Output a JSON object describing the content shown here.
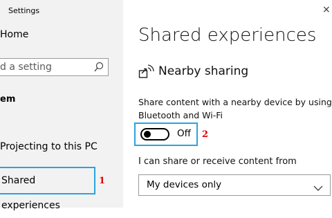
{
  "window": {
    "title": "Settings",
    "close_glyph": "×"
  },
  "sidebar": {
    "home_label": "Home",
    "search_placeholder": "d a setting",
    "section_heading": "em",
    "items": [
      {
        "label": "Projecting to this PC"
      },
      {
        "label": "Shared experiences"
      }
    ]
  },
  "main": {
    "title": "Shared experiences",
    "nearby": {
      "heading": "Nearby sharing",
      "description": "Share content with a nearby device by using Bluetooth and Wi-Fi",
      "toggle_state": "Off"
    },
    "share_from": {
      "label": "I can share or receive content from",
      "selected": "My devices only"
    }
  },
  "annotations": {
    "callout_1": "1",
    "callout_2": "2"
  },
  "colors": {
    "highlight": "#29a3e0",
    "callout": "#e00000",
    "sidebar_bg": "#f2f2f2"
  },
  "icons": [
    "search-icon",
    "nearby-sharing-icon",
    "chevron-down-icon",
    "close-icon"
  ]
}
